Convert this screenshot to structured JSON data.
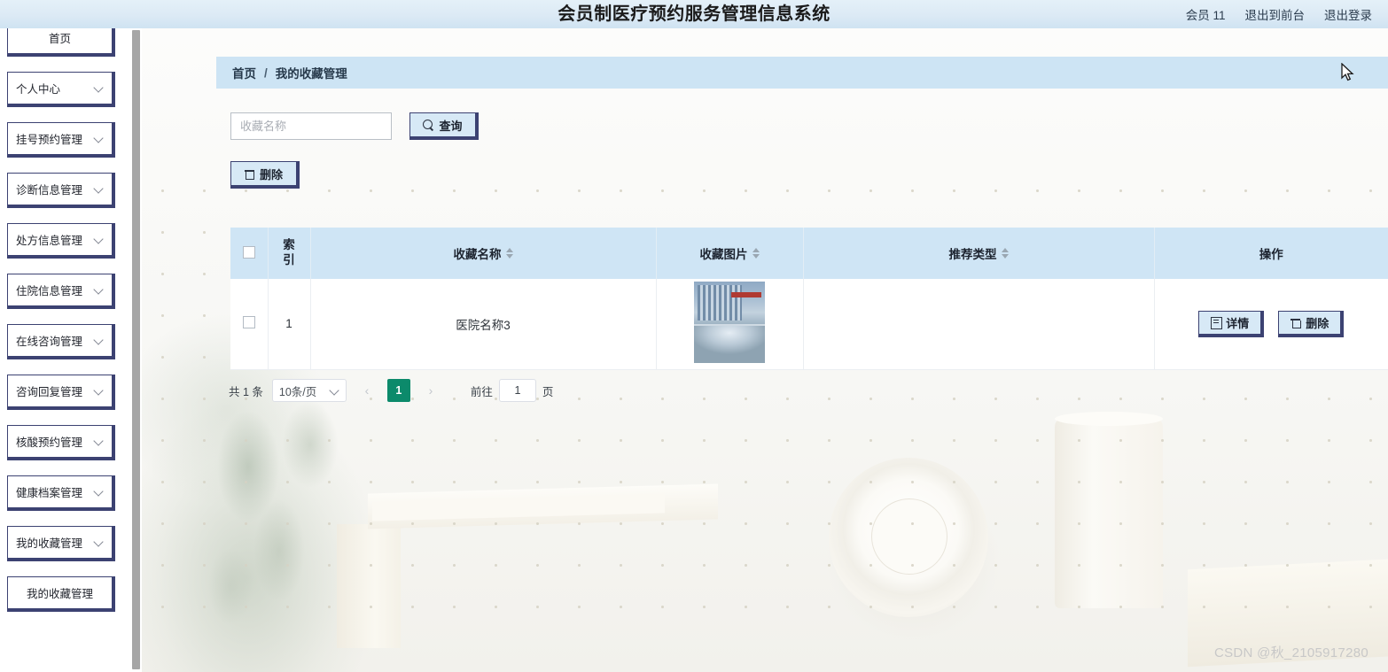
{
  "header": {
    "title": "会员制医疗预约服务管理信息系统",
    "links": [
      {
        "label": "会员 11",
        "name": "member-label"
      },
      {
        "label": "退出到前台",
        "name": "exit-to-front-link"
      },
      {
        "label": "退出登录",
        "name": "logout-link"
      }
    ]
  },
  "sidebar": {
    "items": [
      {
        "label": "首页",
        "expandable": false,
        "centered": true
      },
      {
        "label": "个人中心",
        "expandable": true,
        "centered": false
      },
      {
        "label": "挂号预约管理",
        "expandable": true,
        "centered": false
      },
      {
        "label": "诊断信息管理",
        "expandable": true,
        "centered": false
      },
      {
        "label": "处方信息管理",
        "expandable": true,
        "centered": false
      },
      {
        "label": "住院信息管理",
        "expandable": true,
        "centered": false
      },
      {
        "label": "在线咨询管理",
        "expandable": true,
        "centered": false
      },
      {
        "label": "咨询回复管理",
        "expandable": true,
        "centered": false
      },
      {
        "label": "核酸预约管理",
        "expandable": true,
        "centered": false
      },
      {
        "label": "健康档案管理",
        "expandable": true,
        "centered": false
      },
      {
        "label": "我的收藏管理",
        "expandable": true,
        "centered": false
      },
      {
        "label": "我的收藏管理",
        "expandable": false,
        "centered": true
      }
    ]
  },
  "breadcrumb": {
    "home": "首页",
    "separator": "/",
    "current": "我的收藏管理"
  },
  "toolbar": {
    "search_placeholder": "收藏名称",
    "search_value": "",
    "query_label": "查询",
    "delete_label": "删除"
  },
  "table": {
    "columns": [
      {
        "label": "索引",
        "sortable": false
      },
      {
        "label": "收藏名称",
        "sortable": true
      },
      {
        "label": "收藏图片",
        "sortable": true
      },
      {
        "label": "推荐类型",
        "sortable": true
      },
      {
        "label": "操作",
        "sortable": false
      }
    ],
    "rows": [
      {
        "index": "1",
        "name": "医院名称3",
        "image_alt": "医院建筑图片",
        "type": "",
        "detail_label": "详情",
        "delete_label": "删除"
      }
    ]
  },
  "pagination": {
    "total_text": "共 1 条",
    "page_size": "10条/页",
    "prev": "‹",
    "next": "›",
    "current_page": "1",
    "jump_prefix": "前往",
    "jump_value": "1",
    "jump_suffix": "页"
  },
  "watermark": "CSDN @秋_2105917280",
  "colors": {
    "header_bg": "#dceaf5",
    "breadcrumb_bg": "#cde4f4",
    "table_header_bg": "#cfe5f5",
    "button_bg": "#d7e9f6",
    "button_border": "#3c4272",
    "pagination_active": "#0c8a6b"
  }
}
